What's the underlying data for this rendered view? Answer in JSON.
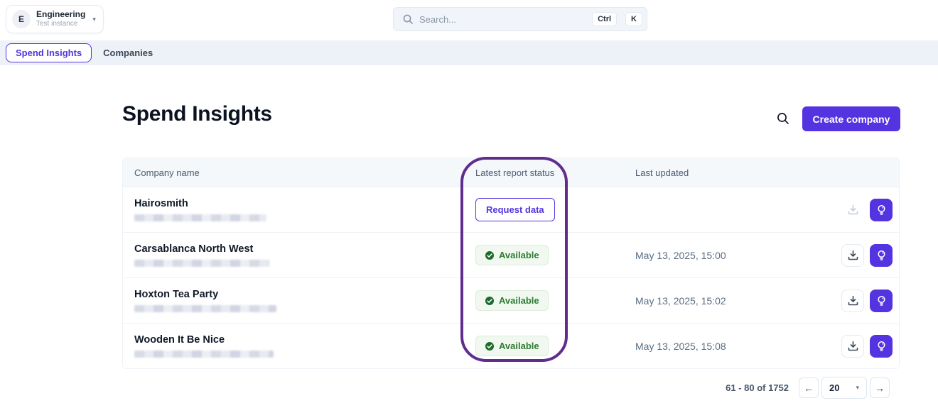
{
  "header": {
    "org": {
      "avatar_initial": "E",
      "name": "Engineering",
      "subtitle": "Test instance"
    },
    "search": {
      "placeholder": "Search...",
      "shortcut_ctrl": "Ctrl",
      "shortcut_key": "K"
    }
  },
  "tabs": [
    {
      "label": "Spend Insights",
      "active": true
    },
    {
      "label": "Companies",
      "active": false
    }
  ],
  "page": {
    "title": "Spend Insights",
    "create_button_label": "Create company"
  },
  "table": {
    "columns": {
      "company": "Company name",
      "status": "Latest report status",
      "updated": "Last updated"
    },
    "rows": [
      {
        "company": "Hairosmith",
        "status": "Request data",
        "status_type": "action",
        "last_updated": "",
        "download_enabled": false
      },
      {
        "company": "Carsablanca North West",
        "status": "Available",
        "status_type": "badge",
        "last_updated": "May 13, 2025, 15:00",
        "download_enabled": true
      },
      {
        "company": "Hoxton Tea Party",
        "status": "Available",
        "status_type": "badge",
        "last_updated": "May 13, 2025, 15:02",
        "download_enabled": true
      },
      {
        "company": "Wooden It Be Nice",
        "status": "Available",
        "status_type": "badge",
        "last_updated": "May 13, 2025, 15:08",
        "download_enabled": true
      }
    ]
  },
  "pagination": {
    "range_label": "61 - 80 of 1752",
    "page_size": "20"
  },
  "icons": {
    "prev": "←",
    "next": "→",
    "caret": "▾"
  },
  "colors": {
    "accent": "#5434e0",
    "annotation": "#602d8f",
    "available_text": "#2e7d32",
    "tabbar_bg": "#edf2f8",
    "table_header_bg": "#f4f8fb"
  }
}
